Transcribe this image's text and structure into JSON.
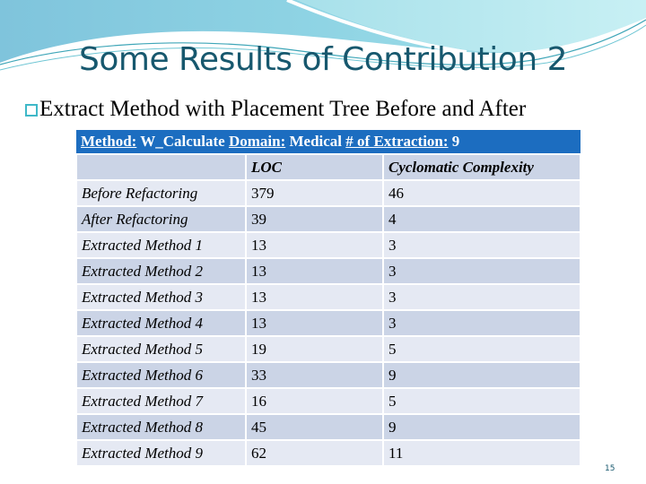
{
  "slide": {
    "title": "Some Results of Contribution 2",
    "bullet": "Extract Method with Placement Tree Before and After",
    "page_number": "15"
  },
  "table": {
    "caption": {
      "method_label": "Method:",
      "method_value": " W_Calculate ",
      "domain_label": "Domain:",
      "domain_value": " Medical ",
      "extraction_label": "# of Extraction:",
      "extraction_value": " 9"
    },
    "columns": [
      "",
      "LOC",
      "Cyclomatic Complexity"
    ],
    "rows": [
      {
        "label": "Before Refactoring",
        "loc": "379",
        "cc": "46"
      },
      {
        "label": "After Refactoring",
        "loc": "39",
        "cc": "4"
      },
      {
        "label": "Extracted Method 1",
        "loc": "13",
        "cc": "3"
      },
      {
        "label": "Extracted Method 2",
        "loc": "13",
        "cc": "3"
      },
      {
        "label": "Extracted Method 3",
        "loc": "13",
        "cc": "3"
      },
      {
        "label": "Extracted Method 4",
        "loc": "13",
        "cc": "3"
      },
      {
        "label": "Extracted Method 5",
        "loc": "19",
        "cc": "5"
      },
      {
        "label": "Extracted Method 6",
        "loc": "33",
        "cc": "9"
      },
      {
        "label": "Extracted Method 7",
        "loc": "16",
        "cc": "5"
      },
      {
        "label": "Extracted Method 8",
        "loc": "45",
        "cc": "9"
      },
      {
        "label": "Extracted Method 9",
        "loc": "62",
        "cc": "11"
      }
    ]
  }
}
